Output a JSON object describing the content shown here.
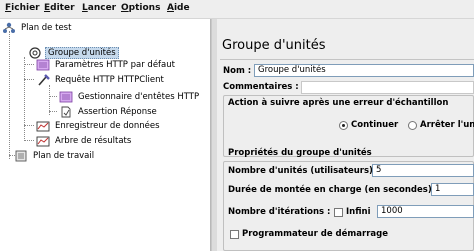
{
  "menu": [
    {
      "label": "Fichier",
      "mnemonic": "F",
      "rest": "ichier"
    },
    {
      "label": "Editer",
      "mnemonic": "E",
      "rest": "diter"
    },
    {
      "label": "Lancer",
      "mnemonic": "L",
      "rest": "ancer"
    },
    {
      "label": "Options",
      "mnemonic": "O",
      "rest": "ptions"
    },
    {
      "label": "Aide",
      "mnemonic": "A",
      "rest": "ide"
    }
  ],
  "tree": {
    "test_plan": "Plan de test",
    "thread_group": "Groupe d'unités",
    "http_defaults": "Paramètres HTTP par défaut",
    "http_request": "Requête HTTP HTTPClient",
    "header_manager": "Gestionnaire d'entêtes HTTP",
    "response_assertion": "Assertion Réponse",
    "data_writer": "Enregistreur de données",
    "results_tree": "Arbre de résultats",
    "workbench": "Plan de travail"
  },
  "panel": {
    "title": "Groupe d'unités",
    "name_label": "Nom :",
    "name_value": "Groupe d'unités",
    "comments_label": "Commentaires :",
    "comments_value": "",
    "error_action_title": "Action à suivre après une erreur d'échantillon",
    "continue_label": "Continuer",
    "stop_thread_label": "Arrêter l'uni",
    "props_title": "Propriétés du groupe d'unités",
    "threads_label": "Nombre d'unités (utilisateurs) :",
    "threads_value": "5",
    "rampup_label": "Durée de montée en charge (en secondes) :",
    "rampup_value": "1",
    "loops_label": "Nombre d'itérations :",
    "infinite_label": "Infini",
    "loops_value": "1000",
    "scheduler_label": "Programmateur de démarrage"
  }
}
